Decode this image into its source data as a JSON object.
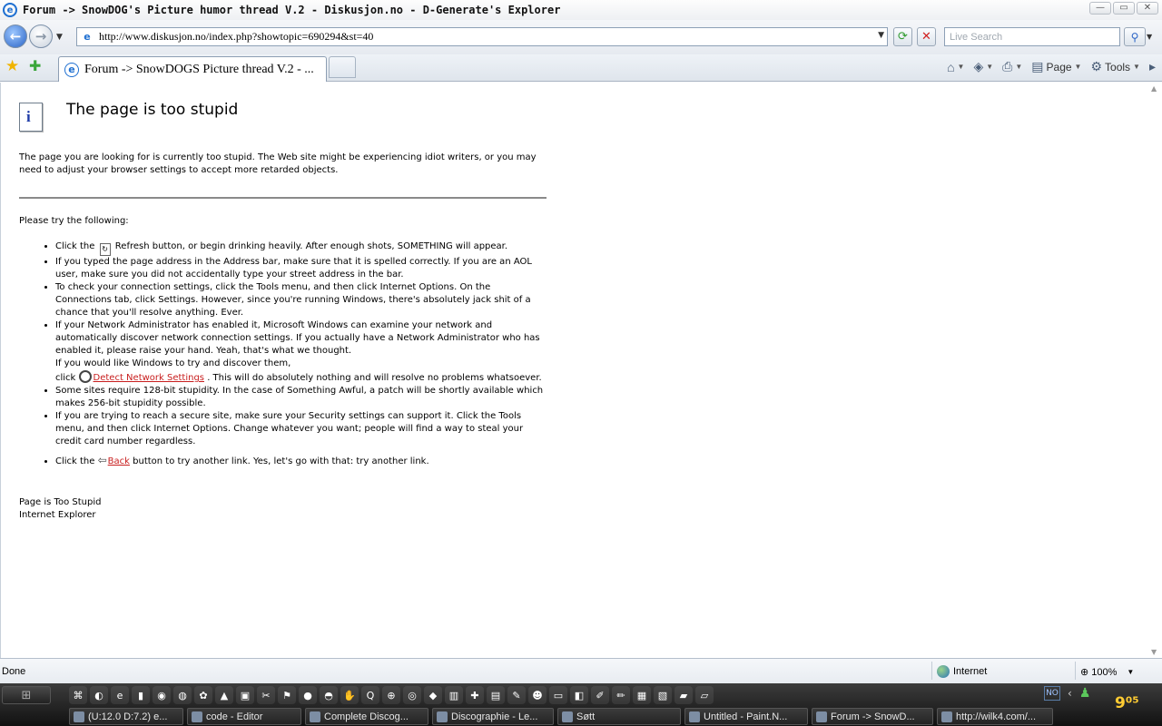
{
  "window": {
    "title": "Forum -> SnowDOG's Picture humor thread V.2 - Diskusjon.no - D-Generate's Explorer",
    "buttons": [
      "—",
      "▭",
      "✕"
    ]
  },
  "address_bar": {
    "url": "http://www.diskusjon.no/index.php?showtopic=690294&st=40",
    "search_placeholder": "Live Search"
  },
  "tabs": [
    {
      "label": "Forum -> SnowDOGS Picture thread V.2 - ..."
    }
  ],
  "command_bar": {
    "page_label": "Page",
    "tools_label": "Tools"
  },
  "error_page": {
    "heading": "The page is too stupid",
    "intro": "The page you are looking for is currently too stupid. The Web site might be experiencing idiot writers, or you may need to adjust your browser settings to accept more retarded objects.",
    "try_label": "Please try the following:",
    "items": {
      "refresh_pre": "Click the",
      "refresh_post": "Refresh button, or begin drinking heavily. After enough shots, SOMETHING will appear.",
      "address": "If you typed the page address in the Address bar, make sure that it is spelled correctly. If you are an AOL user, make sure you did not accidentally type your street address in the bar.",
      "connection": "To check your connection settings, click the Tools menu, and then click Internet Options. On the Connections tab, click Settings. However, since you're running Windows, there's absolutely jack shit of a chance that you'll resolve anything. Ever.",
      "network_1": "If your Network Administrator has enabled it, Microsoft Windows can examine your network and automatically discover network connection settings. If you actually have a Network Administrator who has enabled it, please raise your hand. Yeah, that's what we thought.",
      "network_2": "If you would like Windows to try and discover them,",
      "network_click": "click",
      "detect_link": "Detect Network Settings",
      "network_3": ". This will do absolutely nothing and will resolve no problems whatsoever.",
      "bits": "Some sites require 128-bit stupidity. In the case of Something Awful, a patch will be shortly available which makes 256-bit stupidity possible.",
      "secure": "If you are trying to reach a secure site, make sure your Security settings can support it. Click the Tools menu, and then click Internet Options. Change whatever you want; people will find a way to steal your credit card number regardless.",
      "back_pre": "Click the",
      "back_link": "Back",
      "back_post": "button to try another link. Yes, let's go with that: try another link."
    },
    "footer_1": "Page is Too Stupid",
    "footer_2": "Internet Explorer"
  },
  "status_bar": {
    "status": "Done",
    "zone": "Internet",
    "zoom": "100%"
  },
  "taskbar": {
    "tasks": [
      "(U:12.0 D:7.2) e...",
      "code - Editor",
      "Complete Discog...",
      "Discographie - Le...",
      "Søtt",
      "Untitled - Paint.N...",
      "Forum -> SnowD...",
      "http://wilk4.com/..."
    ],
    "language": "NO",
    "clock": "9⁰⁵"
  }
}
